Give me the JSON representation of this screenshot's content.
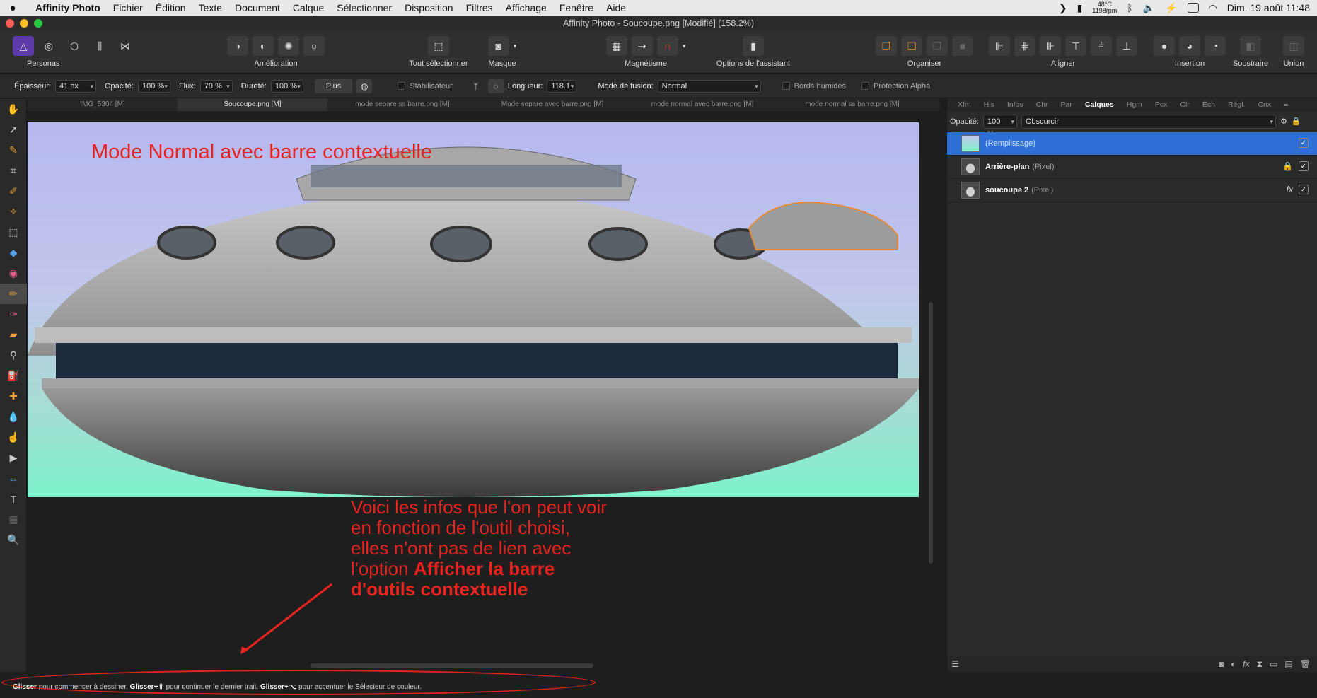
{
  "menubar": {
    "app": "Affinity Photo",
    "items": [
      "Fichier",
      "Édition",
      "Texte",
      "Document",
      "Calque",
      "Sélectionner",
      "Disposition",
      "Filtres",
      "Affichage",
      "Fenêtre",
      "Aide"
    ],
    "temp": "48°C",
    "rpm": "1198rpm",
    "datetime": "Dim. 19 août  11:48"
  },
  "window": {
    "title": "Affinity Photo - Soucoupe.png [Modifié] (158.2%)"
  },
  "toolbar": {
    "personas": "Personas",
    "amelioration": "Amélioration",
    "select_all": "Tout sélectionner",
    "masque": "Masque",
    "magnetisme": "Magnétisme",
    "assistant": "Options de l'assistant",
    "organiser": "Organiser",
    "aligner": "Aligner",
    "insertion": "Insertion",
    "soustraire": "Soustraire",
    "union": "Union"
  },
  "context": {
    "epaisseur_label": "Épaisseur:",
    "epaisseur_value": "41 px",
    "opacite_label": "Opacité:",
    "opacite_value": "100 %",
    "flux_label": "Flux:",
    "flux_value": "79 %",
    "durete_label": "Dureté:",
    "durete_value": "100 %",
    "plus": "Plus",
    "stabilisateur": "Stabilisateur",
    "longueur_label": "Longueur:",
    "longueur_value": "118.1",
    "fusion_label": "Mode de fusion:",
    "fusion_value": "Normal",
    "bords_humides": "Bords humides",
    "protection_alpha": "Protection Alpha"
  },
  "tabs": [
    "IMG_5304 [M]",
    "Soucoupe.png [M]",
    "mode separe ss barre.png [M]",
    "Mode separe avec barre.png [M]",
    "mode normal avec barre.png [M]",
    "mode normal ss barre.png [M]"
  ],
  "annotations": {
    "top": "Mode Normal avec barre contextuelle",
    "line1": "Voici les infos que l'on peut voir",
    "line2": "en fonction de l'outil choisi,",
    "line3": "elles n'ont pas de lien avec",
    "line4_a": "l'option ",
    "line4_b": "Afficher la barre",
    "line5": "d'outils contextuelle"
  },
  "panel": {
    "tabs": [
      "Xfm",
      "Hls",
      "Infos",
      "Chr",
      "Par",
      "Calques",
      "Hgm",
      "Pcx",
      "Clr",
      "Éch",
      "Régl.",
      "Cnx"
    ],
    "active_tab": "Calques",
    "opacity_label": "Opacité:",
    "opacity_value": "100 %",
    "blend_value": "Obscurcir",
    "layers": [
      {
        "name": "",
        "type": "(Remplissage)"
      },
      {
        "name": "Arrière-plan",
        "type": "(Pixel)"
      },
      {
        "name": "soucoupe  2",
        "type": "(Pixel)"
      }
    ]
  },
  "status": {
    "k1": "Glisser",
    "t1": " pour commencer à dessiner. ",
    "k2": "Glisser+⇧",
    "t2": " pour continuer le dernier trait. ",
    "k3": "Glisser+⌥",
    "t3": " pour accentuer le Sélecteur de couleur."
  },
  "colors": {
    "accent": "#2d6fd6",
    "annotation": "#e8221e"
  }
}
